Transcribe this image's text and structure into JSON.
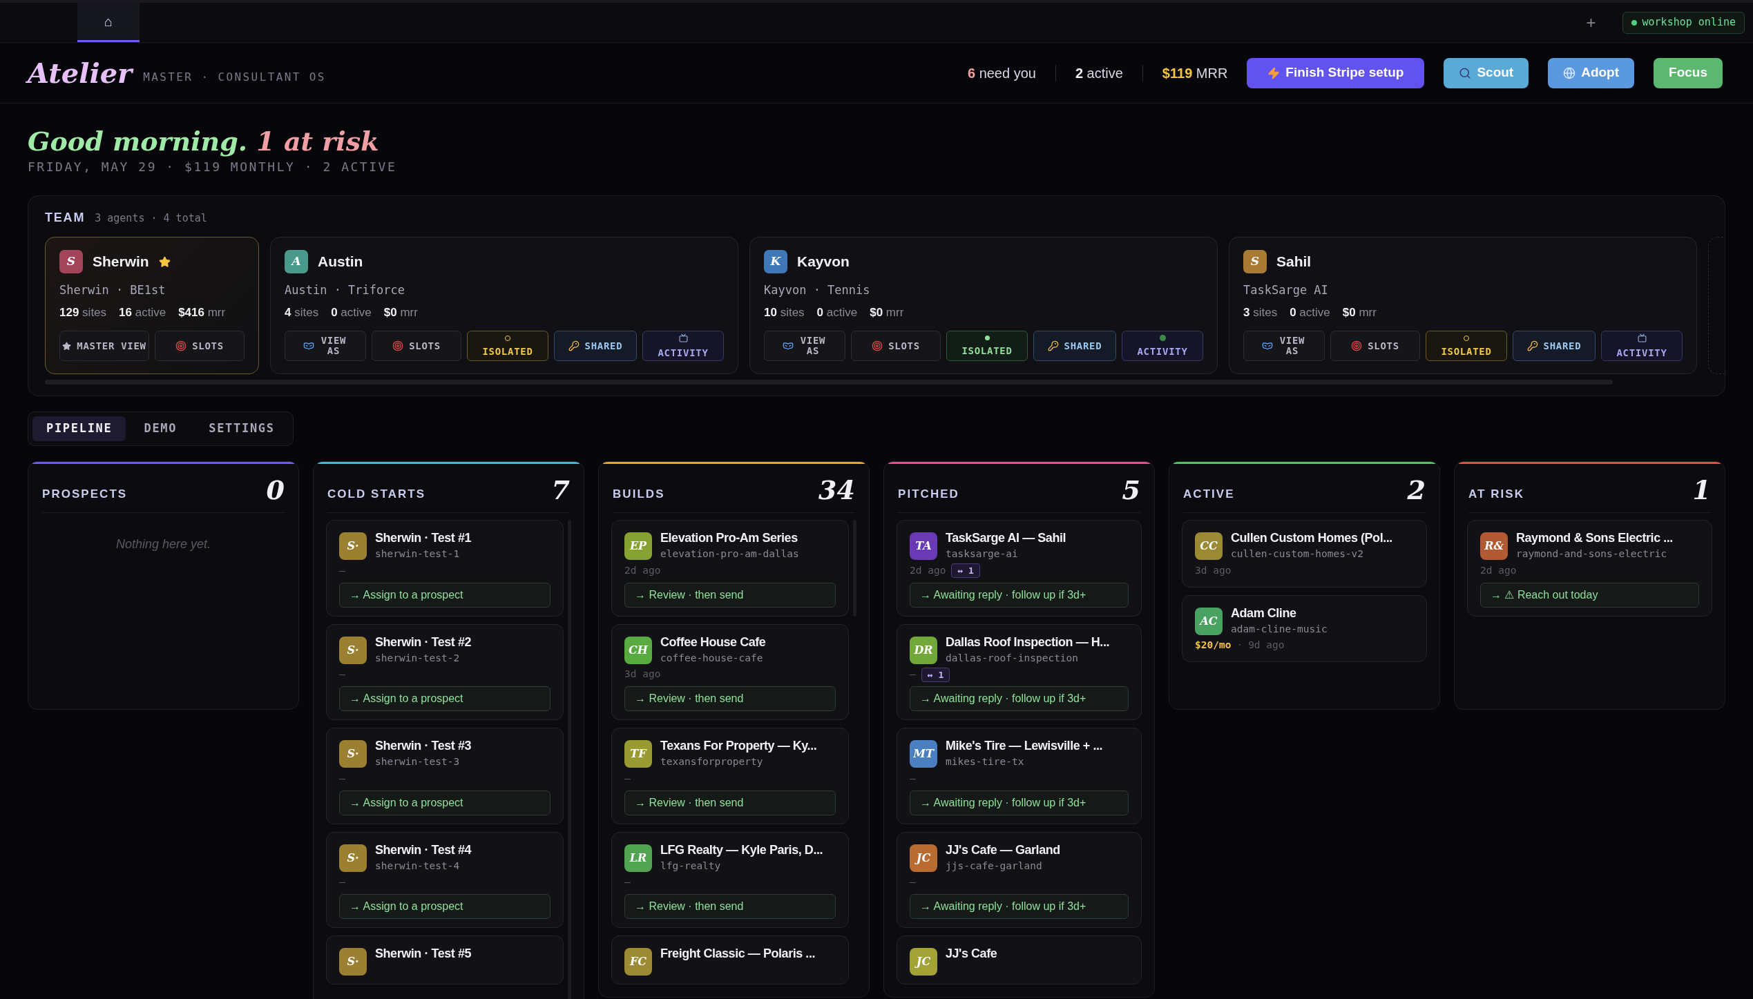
{
  "topbar": {
    "home_tab": {
      "label": "⌂",
      "selected": true
    },
    "add_tab": "+",
    "status": {
      "label": "workshop online",
      "online": true
    }
  },
  "header": {
    "logo": "Atelier",
    "tagline": "MASTER · CONSULTANT OS",
    "stats": [
      {
        "value": "6",
        "label": "need you",
        "color": "#f0a0a0"
      },
      {
        "value": "2",
        "label": "active",
        "color": "#f2f2f7"
      },
      {
        "value": "$119",
        "label": "MRR",
        "color": "#f5c542"
      }
    ],
    "buttons": [
      {
        "kind": "stripe",
        "label": "Finish Stripe setup"
      },
      {
        "kind": "scout",
        "label": "Scout"
      },
      {
        "kind": "adopt",
        "label": "Adopt"
      },
      {
        "kind": "focus",
        "label": "Focus"
      }
    ]
  },
  "greeting": {
    "text": "Good morning.",
    "risk": "1 at risk",
    "subtitle": "FRIDAY, MAY 29 · $119 MONTHLY · 2 ACTIVE"
  },
  "team": {
    "title": "TEAM",
    "summary": "3 agents · 4 total",
    "members": [
      {
        "initial": "S",
        "color": "#a4445a",
        "name": "Sherwin",
        "starred": true,
        "master": true,
        "subtitle": "Sherwin · BE1st",
        "stats": [
          "**129** sites",
          "**16** active",
          "**$416** mrr"
        ],
        "buttons": [
          {
            "kind": "master_view",
            "label": "MASTER VIEW"
          },
          {
            "kind": "slots",
            "label": "SLOTS"
          }
        ]
      },
      {
        "initial": "A",
        "color": "#4a9a8c",
        "name": "Austin",
        "starred": false,
        "master": false,
        "subtitle": "Austin · Triforce",
        "stats": [
          "**4** sites",
          "**0** active",
          "**$0** mrr"
        ],
        "buttons": [
          {
            "kind": "view_as",
            "label": "VIEW AS"
          },
          {
            "kind": "slots",
            "label": "SLOTS"
          },
          {
            "kind": "isolated",
            "label": "ISOLATED",
            "on": false
          },
          {
            "kind": "shared",
            "label": "SHARED"
          },
          {
            "kind": "activity",
            "label": "ACTIVITY",
            "on": false
          }
        ]
      },
      {
        "initial": "K",
        "color": "#3f78b8",
        "name": "Kayvon",
        "starred": false,
        "master": false,
        "subtitle": "Kayvon · Tennis",
        "stats": [
          "**10** sites",
          "**0** active",
          "**$0** mrr"
        ],
        "buttons": [
          {
            "kind": "view_as",
            "label": "VIEW AS"
          },
          {
            "kind": "slots",
            "label": "SLOTS"
          },
          {
            "kind": "isolated",
            "label": "ISOLATED",
            "on": true
          },
          {
            "kind": "shared",
            "label": "SHARED"
          },
          {
            "kind": "activity",
            "label": "ACTIVITY",
            "on": true
          }
        ]
      },
      {
        "initial": "S",
        "color": "#a87a34",
        "name": "Sahil",
        "starred": false,
        "master": false,
        "subtitle": "TaskSarge AI",
        "stats": [
          "**3** sites",
          "**0** active",
          "**$0** mrr"
        ],
        "buttons": [
          {
            "kind": "view_as",
            "label": "VIEW AS"
          },
          {
            "kind": "slots",
            "label": "SLOTS"
          },
          {
            "kind": "isolated",
            "label": "ISOLATED",
            "on": false
          },
          {
            "kind": "shared",
            "label": "SHARED"
          },
          {
            "kind": "activity",
            "label": "ACTIVITY",
            "on": false
          }
        ]
      }
    ]
  },
  "tabs": [
    {
      "label": "PIPELINE",
      "selected": true
    },
    {
      "label": "DEMO",
      "selected": false
    },
    {
      "label": "SETTINGS",
      "selected": false
    }
  ],
  "columns": [
    {
      "title": "PROSPECTS",
      "count": "0",
      "color": "#6d5cf0",
      "empty": "Nothing here yet."
    },
    {
      "title": "COLD STARTS",
      "count": "7",
      "color": "#4cb4d4",
      "scrollable": true,
      "cards": [
        {
          "initials": "S·",
          "color": "#9c8032",
          "title": "Sherwin · Test #1",
          "slug": "sherwin-test-1",
          "meta": "—",
          "action": "→ Assign to a prospect"
        },
        {
          "initials": "S·",
          "color": "#9c8032",
          "title": "Sherwin · Test #2",
          "slug": "sherwin-test-2",
          "meta": "—",
          "action": "→ Assign to a prospect"
        },
        {
          "initials": "S·",
          "color": "#9c8032",
          "title": "Sherwin · Test #3",
          "slug": "sherwin-test-3",
          "meta": "—",
          "action": "→ Assign to a prospect"
        },
        {
          "initials": "S·",
          "color": "#9c8032",
          "title": "Sherwin · Test #4",
          "slug": "sherwin-test-4",
          "meta": "—",
          "action": "→ Assign to a prospect"
        },
        {
          "initials": "S·",
          "color": "#9c8032",
          "title": "Sherwin · Test #5"
        }
      ]
    },
    {
      "title": "BUILDS",
      "count": "34",
      "color": "#e8a235",
      "scrollable": true,
      "cards": [
        {
          "initials": "EP",
          "color": "#86a232",
          "title": "Elevation Pro-Am Series",
          "slug": "elevation-pro-am-dallas",
          "meta": "2d ago",
          "action": "→ Review · then send"
        },
        {
          "initials": "CH",
          "color": "#5aaa42",
          "title": "Coffee House Cafe",
          "slug": "coffee-house-cafe",
          "meta": "3d ago",
          "action": "→ Review · then send"
        },
        {
          "initials": "TF",
          "color": "#9a9a32",
          "title": "Texans For Property — Ky...",
          "slug": "texansforproperty",
          "meta": "—",
          "action": "→ Review · then send"
        },
        {
          "initials": "LR",
          "color": "#50a452",
          "title": "LFG Realty — Kyle Paris, D...",
          "slug": "lfg-realty",
          "meta": "—",
          "action": "→ Review · then send"
        },
        {
          "initials": "FC",
          "color": "#9c8a34",
          "title": "Freight Classic — Polaris ..."
        }
      ]
    },
    {
      "title": "PITCHED",
      "count": "5",
      "color": "#e0508c",
      "cards": [
        {
          "initials": "TA",
          "color": "#6a3ab4",
          "title": "TaskSarge AI — Sahil",
          "slug": "tasksarge-ai",
          "meta": "2d ago",
          "badge": "↔ 1",
          "action": "→ Awaiting reply · follow up if 3d+"
        },
        {
          "initials": "DR",
          "color": "#72a83a",
          "title": "Dallas Roof Inspection — H...",
          "slug": "dallas-roof-inspection",
          "meta": "—",
          "badge": "↔ 1",
          "action": "→ Awaiting reply · follow up if 3d+"
        },
        {
          "initials": "MT",
          "color": "#4a80c2",
          "title": "Mike's Tire — Lewisville + ...",
          "slug": "mikes-tire-tx",
          "meta": "—",
          "action": "→ Awaiting reply · follow up if 3d+"
        },
        {
          "initials": "JC",
          "color": "#b86c32",
          "title": "JJ's Cafe — Garland",
          "slug": "jjs-cafe-garland",
          "meta": "—",
          "action": "→ Awaiting reply · follow up if 3d+"
        },
        {
          "initials": "JC",
          "color": "#a2a236",
          "title": "JJ's Cafe"
        }
      ]
    },
    {
      "title": "ACTIVE",
      "count": "2",
      "color": "#52c262",
      "cards": [
        {
          "initials": "CC",
          "color": "#9a8a34",
          "title": "Cullen Custom Homes (Pol...",
          "slug": "cullen-custom-homes-v2",
          "meta": "3d ago"
        },
        {
          "initials": "AC",
          "color": "#4aa262",
          "title": "Adam Cline",
          "slug": "adam-cline-music",
          "price": "$20/mo",
          "separator": "·",
          "meta": "9d ago"
        }
      ]
    },
    {
      "title": "AT RISK",
      "count": "1",
      "color": "#e05444",
      "cards": [
        {
          "initials": "R&",
          "color": "#b25a34",
          "title": "Raymond & Sons Electric ...",
          "slug": "raymond-and-sons-electric",
          "meta": "2d ago",
          "action": "→ ⚠ Reach out today"
        }
      ]
    }
  ]
}
